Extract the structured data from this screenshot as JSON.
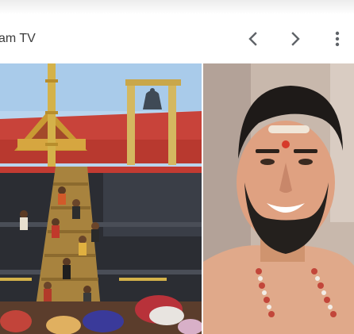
{
  "header": {
    "title": "am TV",
    "prev_icon": "chevron-left-icon",
    "next_icon": "chevron-right-icon",
    "more_icon": "more-vert-icon"
  },
  "gallery": {
    "images": [
      {
        "name": "temple-image"
      },
      {
        "name": "person-image"
      }
    ]
  },
  "colors": {
    "title_text": "#3c3c3c",
    "icon": "#5f6368",
    "temple_roof": "#c94030",
    "sky": "#b8d4ec"
  }
}
